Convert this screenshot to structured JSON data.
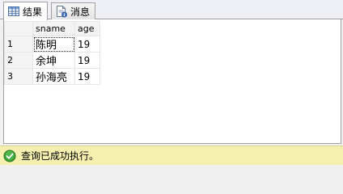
{
  "tabs": [
    {
      "label": "结果",
      "icon": "grid-icon",
      "active": true
    },
    {
      "label": "消息",
      "icon": "message-icon",
      "active": false
    }
  ],
  "grid": {
    "columns": [
      "sname",
      "age"
    ],
    "rows": [
      {
        "num": "1",
        "sname": "陈明",
        "age": "19"
      },
      {
        "num": "2",
        "sname": "余坤",
        "age": "19"
      },
      {
        "num": "3",
        "sname": "孙海亮",
        "age": "19"
      }
    ]
  },
  "status": {
    "icon": "success-check-icon",
    "text": "查询已成功执行。",
    "color": "#f5f0b0"
  }
}
